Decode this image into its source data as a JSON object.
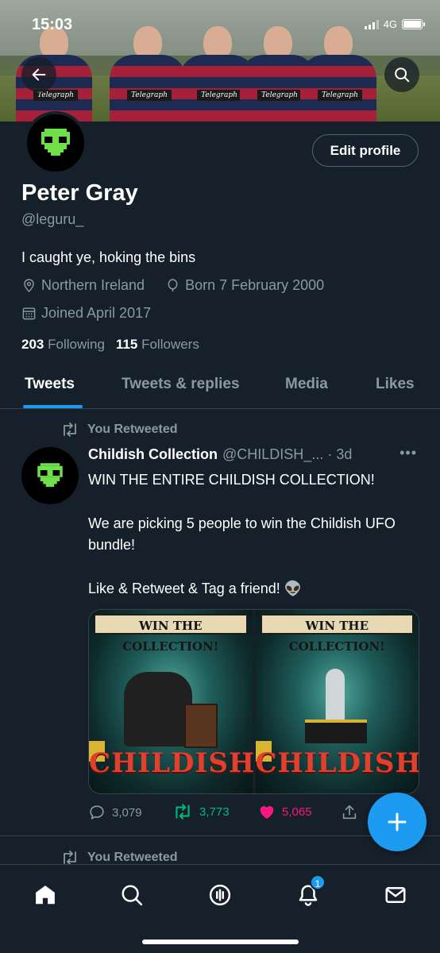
{
  "status_bar": {
    "time": "15:03",
    "network": "4G"
  },
  "banner": {
    "sponsor_text": "Telegraph"
  },
  "profile": {
    "edit_label": "Edit profile",
    "name": "Peter Gray",
    "handle": "@leguru_",
    "bio": "I caught ye, hoking the bins",
    "location": "Northern Ireland",
    "birth": "Born 7 February 2000",
    "joined": "Joined April 2017",
    "following_count": "203",
    "following_label": "Following",
    "followers_count": "115",
    "followers_label": "Followers"
  },
  "tabs": [
    {
      "label": "Tweets",
      "active": true
    },
    {
      "label": "Tweets & replies",
      "active": false
    },
    {
      "label": "Media",
      "active": false
    },
    {
      "label": "Likes",
      "active": false
    }
  ],
  "tweet": {
    "retweet_label": "You Retweeted",
    "author": "Childish Collection",
    "meta": "@CHILDISH_... · 3d",
    "more": "•••",
    "line1": "WIN THE ENTIRE CHILDISH COLLECTION!",
    "line2": "We are picking 5 people to win the Childish UFO bundle!",
    "line3": "Like & Retweet & Tag a friend! 👽",
    "media": [
      {
        "title": "WIN THE COLLECTION!",
        "brand": "CHILDISH"
      },
      {
        "title": "WIN THE COLLECTION!",
        "brand": "CHILDISH"
      }
    ],
    "replies": "3,079",
    "retweets": "3,773",
    "likes": "5,065"
  },
  "next_tweet": {
    "retweet_label": "You Retweeted"
  },
  "bottom_nav": {
    "notifications_badge": "1"
  },
  "colors": {
    "background": "#15202b",
    "accent": "#1d9bf0",
    "retweet": "#00ba7c",
    "like": "#f91880",
    "muted": "#8b98a5"
  }
}
